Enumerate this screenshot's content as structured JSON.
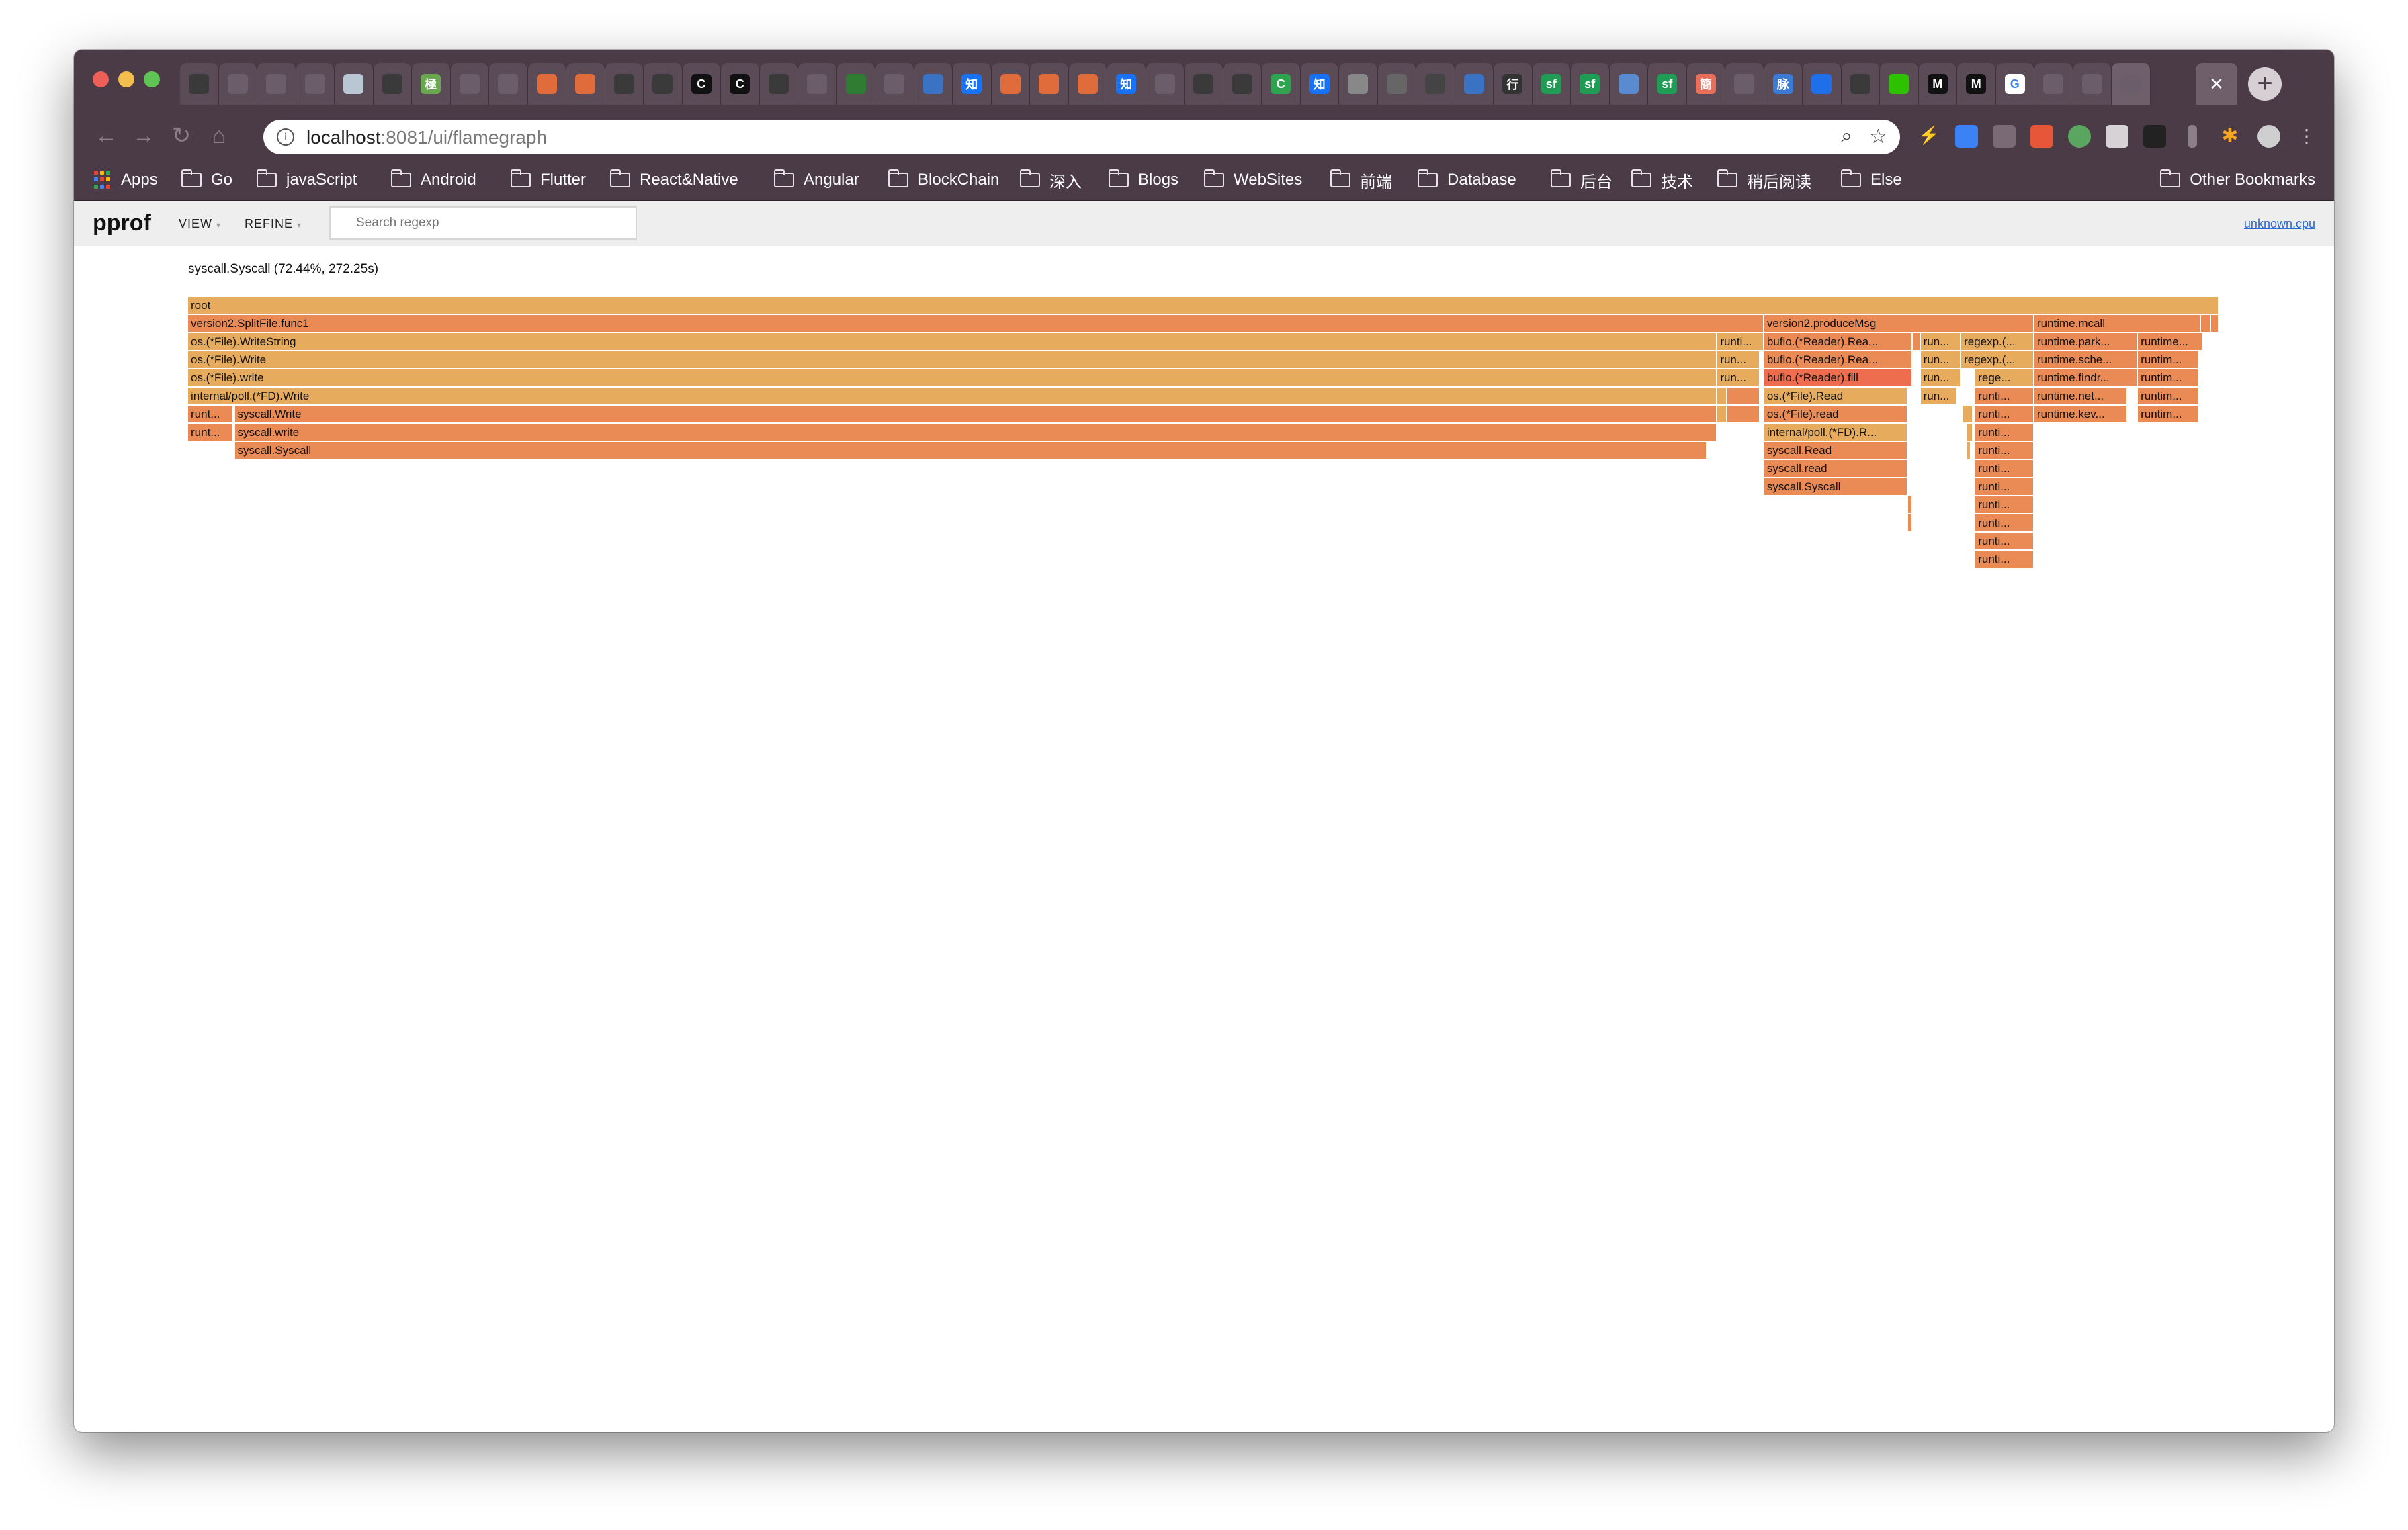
{
  "tabs": [
    {
      "icon": "github-icon",
      "glyph": "",
      "bg": "#3a3a3a"
    },
    {
      "icon": "page-icon",
      "glyph": "",
      "bg": "#6b5d69"
    },
    {
      "icon": "page-icon",
      "glyph": "",
      "bg": "#6b5d69"
    },
    {
      "icon": "app-icon",
      "glyph": "",
      "bg": "#6b5d69"
    },
    {
      "icon": "avatar-icon",
      "glyph": "",
      "bg": "#b9c7d4"
    },
    {
      "icon": "github-icon",
      "glyph": "",
      "bg": "#3a3a3a"
    },
    {
      "icon": "green-app-icon",
      "glyph": "極",
      "bg": "#6aa84f"
    },
    {
      "icon": "page-icon",
      "glyph": "",
      "bg": "#6b5d69"
    },
    {
      "icon": "page-icon",
      "glyph": "",
      "bg": "#6b5d69"
    },
    {
      "icon": "gitlab-icon",
      "glyph": "",
      "bg": "#e06c3c"
    },
    {
      "icon": "gitlab-icon",
      "glyph": "",
      "bg": "#e06c3c"
    },
    {
      "icon": "github-icon",
      "glyph": "",
      "bg": "#3a3a3a"
    },
    {
      "icon": "github-icon",
      "glyph": "",
      "bg": "#3a3a3a"
    },
    {
      "icon": "c-icon",
      "glyph": "C",
      "bg": "#111111"
    },
    {
      "icon": "c-icon",
      "glyph": "C",
      "bg": "#111111"
    },
    {
      "icon": "github-icon",
      "glyph": "",
      "bg": "#3a3a3a"
    },
    {
      "icon": "app-icon",
      "glyph": "",
      "bg": "#6b5d69"
    },
    {
      "icon": "green-app-icon",
      "glyph": "",
      "bg": "#2e7d32"
    },
    {
      "icon": "app-icon",
      "glyph": "",
      "bg": "#6b5d69"
    },
    {
      "icon": "blue-app-icon",
      "glyph": "",
      "bg": "#3a72c4"
    },
    {
      "icon": "zhihu-icon",
      "glyph": "知",
      "bg": "#1772f6"
    },
    {
      "icon": "gitlab-icon",
      "glyph": "",
      "bg": "#e06c3c"
    },
    {
      "icon": "gitlab-icon",
      "glyph": "",
      "bg": "#e06c3c"
    },
    {
      "icon": "gitlab-icon",
      "glyph": "",
      "bg": "#e06c3c"
    },
    {
      "icon": "zhihu-icon",
      "glyph": "知",
      "bg": "#1772f6"
    },
    {
      "icon": "book-icon",
      "glyph": "",
      "bg": "#6b5d69"
    },
    {
      "icon": "github-icon",
      "glyph": "",
      "bg": "#3a3a3a"
    },
    {
      "icon": "github-icon",
      "glyph": "",
      "bg": "#3a3a3a"
    },
    {
      "icon": "c-icon",
      "glyph": "C",
      "bg": "#2ea44f"
    },
    {
      "icon": "zhihu-icon",
      "glyph": "知",
      "bg": "#1772f6"
    },
    {
      "icon": "photo-icon",
      "glyph": "",
      "bg": "#888888"
    },
    {
      "icon": "photo-icon",
      "glyph": "",
      "bg": "#666666"
    },
    {
      "icon": "photo-icon",
      "glyph": "",
      "bg": "#444444"
    },
    {
      "icon": "blue-app-icon",
      "glyph": "",
      "bg": "#3a72c4"
    },
    {
      "icon": "text-icon",
      "glyph": "行",
      "bg": "#333333"
    },
    {
      "icon": "sf-icon",
      "glyph": "sf",
      "bg": "#1f9d55"
    },
    {
      "icon": "sf-icon",
      "glyph": "sf",
      "bg": "#1f9d55"
    },
    {
      "icon": "app-icon",
      "glyph": "",
      "bg": "#5a8ad0"
    },
    {
      "icon": "sf-icon",
      "glyph": "sf",
      "bg": "#1f9d55"
    },
    {
      "icon": "jianshu-icon",
      "glyph": "簡",
      "bg": "#ea6f5a"
    },
    {
      "icon": "book-icon",
      "glyph": "",
      "bg": "#6b5d69"
    },
    {
      "icon": "maimai-icon",
      "glyph": "脉",
      "bg": "#3a7bd5"
    },
    {
      "icon": "flag-icon",
      "glyph": "",
      "bg": "#1f6feb"
    },
    {
      "icon": "github-icon",
      "glyph": "",
      "bg": "#3a3a3a"
    },
    {
      "icon": "wechat-icon",
      "glyph": "",
      "bg": "#2dc100"
    },
    {
      "icon": "medium-icon",
      "glyph": "M",
      "bg": "#111111"
    },
    {
      "icon": "medium-icon",
      "glyph": "M",
      "bg": "#111111"
    },
    {
      "icon": "google-icon",
      "glyph": "G",
      "bg": "#ffffff"
    },
    {
      "icon": "page-icon",
      "glyph": "",
      "bg": "#6b5d69"
    },
    {
      "icon": "page-icon",
      "glyph": "",
      "bg": "#6b5d69"
    },
    {
      "icon": "page-icon",
      "glyph": "",
      "bg": "#6b5d69"
    }
  ],
  "address": {
    "host": "localhost",
    "path": ":8081/ui/flamegraph"
  },
  "bookmarks": [
    {
      "label": "Apps",
      "type": "apps"
    },
    {
      "label": "Go",
      "type": "folder"
    },
    {
      "label": "javaScript",
      "type": "folder"
    },
    {
      "label": "Android",
      "type": "folder"
    },
    {
      "label": "Flutter",
      "type": "folder"
    },
    {
      "label": "React&Native",
      "type": "folder"
    },
    {
      "label": "Angular",
      "type": "folder"
    },
    {
      "label": "BlockChain",
      "type": "folder"
    },
    {
      "label": "深入",
      "type": "folder"
    },
    {
      "label": "Blogs",
      "type": "folder"
    },
    {
      "label": "WebSites",
      "type": "folder"
    },
    {
      "label": "前端",
      "type": "folder"
    },
    {
      "label": "Database",
      "type": "folder"
    },
    {
      "label": "后台",
      "type": "folder"
    },
    {
      "label": "技术",
      "type": "folder"
    },
    {
      "label": "稍后阅读",
      "type": "folder"
    },
    {
      "label": "Else",
      "type": "folder"
    }
  ],
  "other_bookmarks": "Other Bookmarks",
  "pprof": {
    "title": "pprof",
    "view": "VIEW",
    "refine": "REFINE",
    "search_placeholder": "Search regexp",
    "profile_link": "unknown.cpu",
    "status": "syscall.Syscall (72.44%, 272.25s)"
  },
  "flame_colors": {
    "yellow": "#e6ab5c",
    "orange": "#ea8a55",
    "red": "#ee6d4f"
  },
  "flame_frames": [
    {
      "label": "root",
      "depth": 0,
      "start": 0.0,
      "end": 1.0,
      "color": "yellow"
    },
    {
      "label": "version2.SplitFile.func1",
      "depth": 1,
      "start": 0.0,
      "end": 0.776,
      "color": "orange"
    },
    {
      "label": "version2.produceMsg",
      "depth": 1,
      "start": 0.776,
      "end": 0.909,
      "color": "orange"
    },
    {
      "label": "runtime.mcall",
      "depth": 1,
      "start": 0.909,
      "end": 0.991,
      "color": "orange"
    },
    {
      "label": "",
      "depth": 1,
      "start": 0.991,
      "end": 0.996,
      "color": "orange"
    },
    {
      "label": "",
      "depth": 1,
      "start": 0.996,
      "end": 1.0,
      "color": "orange"
    },
    {
      "label": "os.(*File).WriteString",
      "depth": 2,
      "start": 0.0,
      "end": 0.753,
      "color": "yellow"
    },
    {
      "label": "runti...",
      "depth": 2,
      "start": 0.753,
      "end": 0.776,
      "color": "yellow"
    },
    {
      "label": "bufio.(*Reader).Rea...",
      "depth": 2,
      "start": 0.776,
      "end": 0.849,
      "color": "orange"
    },
    {
      "label": "",
      "depth": 2,
      "start": 0.849,
      "end": 0.853,
      "color": "orange"
    },
    {
      "label": "run...",
      "depth": 2,
      "start": 0.853,
      "end": 0.873,
      "color": "yellow"
    },
    {
      "label": "regexp.(...",
      "depth": 2,
      "start": 0.873,
      "end": 0.909,
      "color": "yellow"
    },
    {
      "label": "runtime.park...",
      "depth": 2,
      "start": 0.909,
      "end": 0.96,
      "color": "orange"
    },
    {
      "label": "runtime...",
      "depth": 2,
      "start": 0.96,
      "end": 0.992,
      "color": "orange"
    },
    {
      "label": "os.(*File).Write",
      "depth": 3,
      "start": 0.0,
      "end": 0.753,
      "color": "yellow"
    },
    {
      "label": "run...",
      "depth": 3,
      "start": 0.753,
      "end": 0.774,
      "color": "yellow"
    },
    {
      "label": "bufio.(*Reader).Rea...",
      "depth": 3,
      "start": 0.776,
      "end": 0.849,
      "color": "orange"
    },
    {
      "label": "run...",
      "depth": 3,
      "start": 0.853,
      "end": 0.873,
      "color": "yellow"
    },
    {
      "label": "regexp.(...",
      "depth": 3,
      "start": 0.873,
      "end": 0.909,
      "color": "yellow"
    },
    {
      "label": "runtime.sche...",
      "depth": 3,
      "start": 0.909,
      "end": 0.96,
      "color": "orange"
    },
    {
      "label": "runtim...",
      "depth": 3,
      "start": 0.96,
      "end": 0.99,
      "color": "orange"
    },
    {
      "label": "os.(*File).write",
      "depth": 4,
      "start": 0.0,
      "end": 0.753,
      "color": "yellow"
    },
    {
      "label": "run...",
      "depth": 4,
      "start": 0.753,
      "end": 0.774,
      "color": "yellow"
    },
    {
      "label": "bufio.(*Reader).fill",
      "depth": 4,
      "start": 0.776,
      "end": 0.849,
      "color": "red"
    },
    {
      "label": "run...",
      "depth": 4,
      "start": 0.853,
      "end": 0.873,
      "color": "yellow"
    },
    {
      "label": "rege...",
      "depth": 4,
      "start": 0.88,
      "end": 0.909,
      "color": "yellow"
    },
    {
      "label": "runtime.findr...",
      "depth": 4,
      "start": 0.909,
      "end": 0.96,
      "color": "orange"
    },
    {
      "label": "runtim...",
      "depth": 4,
      "start": 0.96,
      "end": 0.99,
      "color": "orange"
    },
    {
      "label": "internal/poll.(*FD).Write",
      "depth": 5,
      "start": 0.0,
      "end": 0.753,
      "color": "yellow"
    },
    {
      "label": "",
      "depth": 5,
      "start": 0.753,
      "end": 0.758,
      "color": "yellow"
    },
    {
      "label": "",
      "depth": 5,
      "start": 0.758,
      "end": 0.774,
      "color": "orange"
    },
    {
      "label": "os.(*File).Read",
      "depth": 5,
      "start": 0.776,
      "end": 0.847,
      "color": "yellow"
    },
    {
      "label": "run...",
      "depth": 5,
      "start": 0.853,
      "end": 0.871,
      "color": "yellow"
    },
    {
      "label": "runti...",
      "depth": 5,
      "start": 0.88,
      "end": 0.909,
      "color": "orange"
    },
    {
      "label": "runtime.net...",
      "depth": 5,
      "start": 0.909,
      "end": 0.955,
      "color": "orange"
    },
    {
      "label": "runtim...",
      "depth": 5,
      "start": 0.96,
      "end": 0.99,
      "color": "orange"
    },
    {
      "label": "runt...",
      "depth": 6,
      "start": 0.0,
      "end": 0.022,
      "color": "orange"
    },
    {
      "label": "syscall.Write",
      "depth": 6,
      "start": 0.023,
      "end": 0.753,
      "color": "orange"
    },
    {
      "label": "",
      "depth": 6,
      "start": 0.753,
      "end": 0.758,
      "color": "yellow"
    },
    {
      "label": "",
      "depth": 6,
      "start": 0.758,
      "end": 0.774,
      "color": "orange"
    },
    {
      "label": "os.(*File).read",
      "depth": 6,
      "start": 0.776,
      "end": 0.847,
      "color": "orange"
    },
    {
      "label": "",
      "depth": 6,
      "start": 0.874,
      "end": 0.879,
      "color": "yellow"
    },
    {
      "label": "runti...",
      "depth": 6,
      "start": 0.88,
      "end": 0.909,
      "color": "orange"
    },
    {
      "label": "runtime.kev...",
      "depth": 6,
      "start": 0.909,
      "end": 0.955,
      "color": "orange"
    },
    {
      "label": "runtim...",
      "depth": 6,
      "start": 0.96,
      "end": 0.99,
      "color": "orange"
    },
    {
      "label": "runt...",
      "depth": 7,
      "start": 0.0,
      "end": 0.022,
      "color": "orange"
    },
    {
      "label": "syscall.write",
      "depth": 7,
      "start": 0.023,
      "end": 0.753,
      "color": "orange"
    },
    {
      "label": "internal/poll.(*FD).R...",
      "depth": 7,
      "start": 0.776,
      "end": 0.847,
      "color": "yellow"
    },
    {
      "label": "",
      "depth": 7,
      "start": 0.876,
      "end": 0.879,
      "color": "yellow"
    },
    {
      "label": "runti...",
      "depth": 7,
      "start": 0.88,
      "end": 0.909,
      "color": "orange"
    },
    {
      "label": "syscall.Syscall",
      "depth": 8,
      "start": 0.023,
      "end": 0.748,
      "color": "orange"
    },
    {
      "label": "syscall.Read",
      "depth": 8,
      "start": 0.776,
      "end": 0.847,
      "color": "orange"
    },
    {
      "label": "",
      "depth": 8,
      "start": 0.876,
      "end": 0.878,
      "color": "yellow"
    },
    {
      "label": "runti...",
      "depth": 8,
      "start": 0.88,
      "end": 0.909,
      "color": "orange"
    },
    {
      "label": "syscall.read",
      "depth": 9,
      "start": 0.776,
      "end": 0.847,
      "color": "orange"
    },
    {
      "label": "runti...",
      "depth": 9,
      "start": 0.88,
      "end": 0.909,
      "color": "orange"
    },
    {
      "label": "syscall.Syscall",
      "depth": 10,
      "start": 0.776,
      "end": 0.847,
      "color": "orange"
    },
    {
      "label": "runti...",
      "depth": 10,
      "start": 0.88,
      "end": 0.909,
      "color": "orange"
    },
    {
      "label": "",
      "depth": 11,
      "start": 0.847,
      "end": 0.849,
      "color": "orange"
    },
    {
      "label": "runti...",
      "depth": 11,
      "start": 0.88,
      "end": 0.909,
      "color": "orange"
    },
    {
      "label": "",
      "depth": 12,
      "start": 0.847,
      "end": 0.849,
      "color": "orange"
    },
    {
      "label": "runti...",
      "depth": 12,
      "start": 0.88,
      "end": 0.909,
      "color": "orange"
    },
    {
      "label": "runti...",
      "depth": 13,
      "start": 0.88,
      "end": 0.909,
      "color": "orange"
    },
    {
      "label": "runti...",
      "depth": 14,
      "start": 0.88,
      "end": 0.909,
      "color": "orange"
    }
  ]
}
